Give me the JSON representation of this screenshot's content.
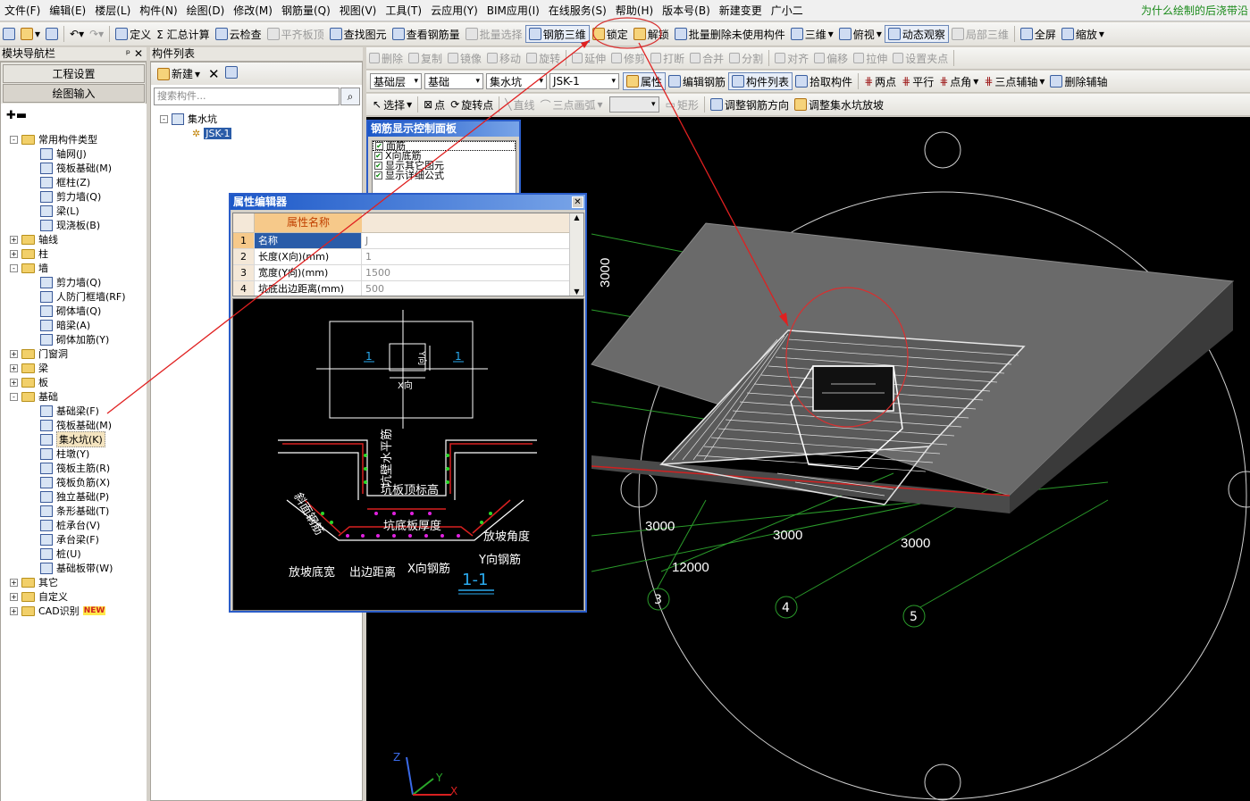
{
  "menu": [
    "文件(F)",
    "编辑(E)",
    "楼层(L)",
    "构件(N)",
    "绘图(D)",
    "修改(M)",
    "钢筋量(Q)",
    "视图(V)",
    "工具(T)",
    "云应用(Y)",
    "BIM应用(I)",
    "在线服务(S)",
    "帮助(H)",
    "版本号(B)",
    "新建变更",
    "广小二"
  ],
  "menu_hint": "为什么绘制的后浇带沿",
  "toolbar1": [
    "定义",
    "Σ 汇总计算",
    "云检查",
    "平齐板顶",
    "查找图元",
    "查看钢筋量",
    "批量选择",
    "钢筋三维",
    "锁定",
    "解锁",
    "批量删除未使用构件",
    "三维",
    "俯视",
    "动态观察",
    "局部三维",
    "全屏",
    "缩放"
  ],
  "toolbar2": [
    "删除",
    "复制",
    "镜像",
    "移动",
    "旋转",
    "延伸",
    "修剪",
    "打断",
    "合并",
    "分割",
    "对齐",
    "偏移",
    "拉伸",
    "设置夹点"
  ],
  "toolbar3": {
    "layer": "基础层",
    "cat": "基础",
    "type": "集水坑",
    "comp": "JSK-1",
    "buttons": [
      "属性",
      "编辑钢筋",
      "构件列表",
      "拾取构件",
      "两点",
      "平行",
      "点角",
      "三点辅轴",
      "删除辅轴"
    ]
  },
  "toolbar4": [
    "选择",
    "点",
    "旋转点",
    "直线",
    "三点画弧",
    "矩形",
    "调整钢筋方向",
    "调整集水坑放坡"
  ],
  "nav": {
    "title": "模块导航栏",
    "btn1": "工程设置",
    "btn2": "绘图输入",
    "tree": [
      {
        "t": "常用构件类型",
        "lv": 0,
        "exp": "-",
        "f": true
      },
      {
        "t": "轴网(J)",
        "lv": 2
      },
      {
        "t": "筏板基础(M)",
        "lv": 2
      },
      {
        "t": "框柱(Z)",
        "lv": 2
      },
      {
        "t": "剪力墙(Q)",
        "lv": 2
      },
      {
        "t": "梁(L)",
        "lv": 2
      },
      {
        "t": "现浇板(B)",
        "lv": 2
      },
      {
        "t": "轴线",
        "lv": 0,
        "exp": "+",
        "f": true
      },
      {
        "t": "柱",
        "lv": 0,
        "exp": "+",
        "f": true
      },
      {
        "t": "墙",
        "lv": 0,
        "exp": "-",
        "f": true
      },
      {
        "t": "剪力墙(Q)",
        "lv": 2
      },
      {
        "t": "人防门框墙(RF)",
        "lv": 2
      },
      {
        "t": "砌体墙(Q)",
        "lv": 2
      },
      {
        "t": "暗梁(A)",
        "lv": 2
      },
      {
        "t": "砌体加筋(Y)",
        "lv": 2
      },
      {
        "t": "门窗洞",
        "lv": 0,
        "exp": "+",
        "f": true
      },
      {
        "t": "梁",
        "lv": 0,
        "exp": "+",
        "f": true
      },
      {
        "t": "板",
        "lv": 0,
        "exp": "+",
        "f": true
      },
      {
        "t": "基础",
        "lv": 0,
        "exp": "-",
        "f": true
      },
      {
        "t": "基础梁(F)",
        "lv": 2
      },
      {
        "t": "筏板基础(M)",
        "lv": 2
      },
      {
        "t": "集水坑(K)",
        "lv": 2,
        "sel": true
      },
      {
        "t": "柱墩(Y)",
        "lv": 2
      },
      {
        "t": "筏板主筋(R)",
        "lv": 2
      },
      {
        "t": "筏板负筋(X)",
        "lv": 2
      },
      {
        "t": "独立基础(P)",
        "lv": 2
      },
      {
        "t": "条形基础(T)",
        "lv": 2
      },
      {
        "t": "桩承台(V)",
        "lv": 2
      },
      {
        "t": "承台梁(F)",
        "lv": 2
      },
      {
        "t": "桩(U)",
        "lv": 2
      },
      {
        "t": "基础板带(W)",
        "lv": 2
      },
      {
        "t": "其它",
        "lv": 0,
        "exp": "+",
        "f": true
      },
      {
        "t": "自定义",
        "lv": 0,
        "exp": "+",
        "f": true
      },
      {
        "t": "CAD识别",
        "lv": 0,
        "exp": "+",
        "f": true,
        "new": "NEW"
      }
    ]
  },
  "complist": {
    "title": "构件列表",
    "new_btn": "新建",
    "search_ph": "搜索构件...",
    "root": "集水坑",
    "child": "JSK-1"
  },
  "rebar_panel": {
    "title": "钢筋显示控制面板",
    "items": [
      "面筋",
      "X向底筋",
      "显示其它图元",
      "显示详细公式"
    ]
  },
  "prop_editor": {
    "title": "属性编辑器",
    "col_header": "属性名称",
    "rows": [
      {
        "n": "1",
        "name": "名称",
        "val": "J"
      },
      {
        "n": "2",
        "name": "长度(X向)(mm)",
        "val": "1"
      },
      {
        "n": "3",
        "name": "宽度(Y向)(mm)",
        "val": "1500"
      },
      {
        "n": "4",
        "name": "坑底出边距离(mm)",
        "val": "500"
      }
    ],
    "sketch": {
      "l1": "1",
      "r1": "1",
      "yaxis": "Y向",
      "xaxis": "X向",
      "v1": "坑壁水平筋",
      "v2": "坑板顶标高",
      "v3": "坑底板厚度",
      "v4": "斜面钢筋",
      "v5": "放坡角度",
      "v6": "放坡底宽",
      "v7": "出边距离",
      "v8": "X向钢筋",
      "v9": "Y向钢筋",
      "sec": "1-1"
    }
  },
  "canvas": {
    "d1": "3000",
    "d2": "3000",
    "d3": "3000",
    "d4": "12000",
    "dv": "3000",
    "ax3": "3",
    "ax4": "4",
    "ax5": "5",
    "z": "Z",
    "y": "Y",
    "x": "X"
  }
}
